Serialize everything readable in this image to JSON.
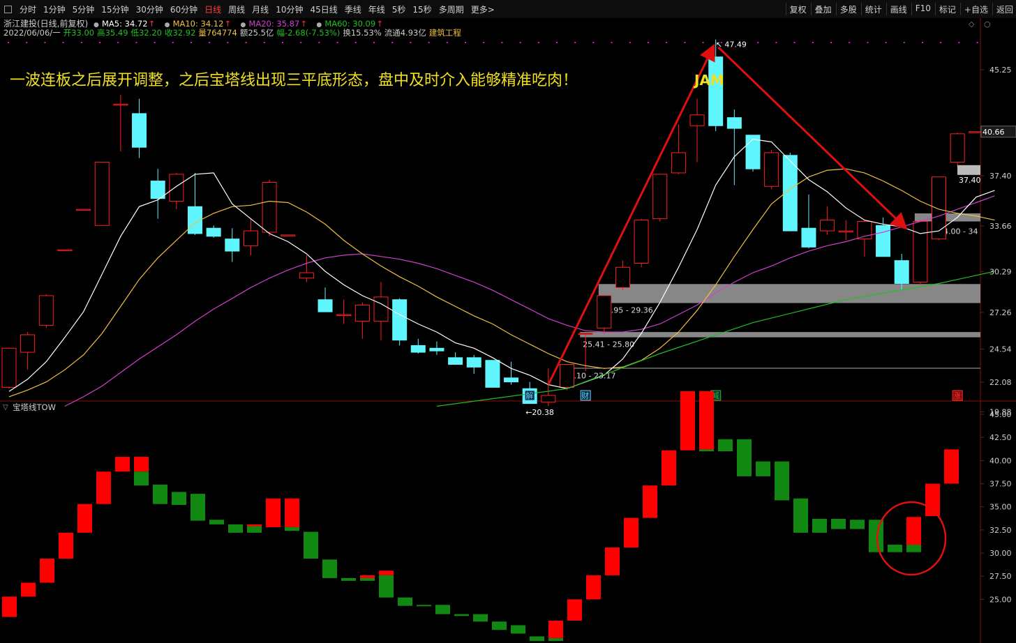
{
  "toolbar": {
    "left": [
      "分时",
      "1分钟",
      "5分钟",
      "15分钟",
      "30分钟",
      "60分钟",
      "日线",
      "周线",
      "月线",
      "10分钟",
      "45日线",
      "季线",
      "年线",
      "5秒",
      "15秒",
      "多周期",
      "更多>"
    ],
    "active": "日线",
    "right": [
      "复权",
      "叠加",
      "多股",
      "统计",
      "画线",
      "F10",
      "标记",
      "+自选",
      "返回"
    ]
  },
  "header": {
    "stock": "浙江建投(日线,前复权)",
    "ma": [
      {
        "label": "MA5: 34.72",
        "color": "#ffffff"
      },
      {
        "label": "MA10: 34.12",
        "color": "#f0c040"
      },
      {
        "label": "MA20: 35.87",
        "color": "#d040d0"
      },
      {
        "label": "MA60: 30.09",
        "color": "#20c020"
      }
    ],
    "info": [
      {
        "text": "2022/06/06/一",
        "color": "#cccccc"
      },
      {
        "text": "开33.00",
        "color": "#20c020"
      },
      {
        "text": "高35.49",
        "color": "#20c020"
      },
      {
        "text": "低32.20",
        "color": "#20c020"
      },
      {
        "text": "收32.92",
        "color": "#20c020"
      },
      {
        "text": "量764774",
        "color": "#f0c040"
      },
      {
        "text": "额25.5亿",
        "color": "#cccccc"
      },
      {
        "text": "幅-2.68(-7.53%)",
        "color": "#20c020"
      },
      {
        "text": "换15.53%",
        "color": "#cccccc"
      },
      {
        "text": "流通4.93亿",
        "color": "#cccccc"
      },
      {
        "text": "建筑工程",
        "color": "#f0c040"
      }
    ],
    "annotation": "一波连板之后展开调整，之后宝塔线出现三平底形态，盘中及时介入能够精准吃肉！",
    "watermark": "JAM"
  },
  "colors": {
    "up": "#ff2020",
    "down": "#5ff5ff",
    "tow_up": "#ff0000",
    "tow_down": "#118811",
    "ma5": "#ffffff",
    "ma10": "#f0c040",
    "ma20": "#d040d0",
    "ma60": "#20c020",
    "arrow": "#e01010"
  },
  "chart_data": [
    {
      "type": "candlestick",
      "title": "浙江建投(日线,前复权)",
      "x": [
        "d1",
        "d2",
        "d3",
        "d4",
        "d5",
        "d6",
        "d7",
        "d8",
        "d9",
        "d10",
        "d11",
        "d12",
        "d13",
        "d14",
        "d15",
        "d16",
        "d17",
        "d18",
        "d19",
        "d20",
        "d21",
        "d22",
        "d23",
        "d24",
        "d25",
        "d26",
        "d27",
        "d28",
        "d29",
        "d30",
        "d31",
        "d32",
        "d33",
        "d34",
        "d35",
        "d36",
        "d37",
        "d38",
        "d39",
        "d40",
        "d41",
        "d42",
        "d43",
        "d44",
        "d45",
        "d46",
        "d47",
        "d48",
        "d49",
        "d50",
        "d51",
        "d52",
        "d53",
        "d54"
      ],
      "ohlc": [
        [
          21.7,
          24.6,
          21.6,
          24.6
        ],
        [
          24.3,
          25.8,
          23.0,
          25.6
        ],
        [
          26.3,
          28.6,
          26.1,
          28.5
        ],
        [
          31.9,
          31.9,
          31.9,
          31.9
        ],
        [
          34.9,
          34.9,
          34.9,
          34.9
        ],
        [
          33.7,
          38.4,
          33.7,
          38.4
        ],
        [
          42.7,
          43.4,
          39.2,
          42.7
        ],
        [
          42.0,
          43.1,
          38.7,
          39.5
        ],
        [
          37.0,
          37.9,
          34.2,
          35.7
        ],
        [
          35.5,
          37.6,
          34.9,
          37.5
        ],
        [
          35.1,
          37.6,
          33.0,
          33.1
        ],
        [
          33.5,
          33.7,
          32.8,
          32.9
        ],
        [
          32.7,
          33.5,
          31.0,
          31.8
        ],
        [
          32.2,
          34.2,
          31.5,
          33.3
        ],
        [
          33.2,
          37.1,
          32.9,
          36.9
        ],
        [
          33.0,
          33.0,
          33.0,
          33.0
        ],
        [
          29.8,
          31.5,
          29.5,
          30.2
        ],
        [
          28.2,
          29.1,
          27.4,
          27.3
        ],
        [
          27.1,
          28.2,
          26.4,
          27.1
        ],
        [
          26.6,
          28.0,
          25.3,
          27.8
        ],
        [
          26.6,
          29.5,
          25.2,
          28.4
        ],
        [
          28.2,
          28.3,
          24.8,
          25.2
        ],
        [
          24.8,
          25.3,
          24.2,
          24.3
        ],
        [
          24.6,
          25.1,
          24.1,
          24.4
        ],
        [
          23.9,
          24.3,
          23.4,
          23.4
        ],
        [
          23.9,
          24.1,
          22.7,
          23.2
        ],
        [
          23.7,
          23.7,
          21.7,
          21.7
        ],
        [
          22.4,
          23.6,
          21.9,
          22.1
        ],
        [
          21.6,
          22.1,
          20.5,
          20.5
        ],
        [
          20.6,
          23.1,
          20.3,
          21.1
        ],
        [
          21.7,
          23.4,
          21.5,
          23.4
        ],
        [
          25.7,
          25.7,
          22.9,
          25.7
        ],
        [
          26.1,
          28.5,
          25.7,
          28.5
        ],
        [
          29.1,
          31.1,
          28.9,
          30.6
        ],
        [
          30.9,
          34.2,
          30.6,
          34.1
        ],
        [
          34.2,
          37.5,
          34.0,
          37.5
        ],
        [
          37.6,
          41.2,
          37.5,
          39.1
        ],
        [
          41.1,
          43.1,
          38.4,
          41.9
        ],
        [
          46.2,
          47.49,
          40.7,
          41.1
        ],
        [
          41.7,
          42.3,
          36.7,
          40.9
        ],
        [
          40.4,
          40.4,
          37.7,
          37.9
        ],
        [
          36.6,
          39.3,
          36.4,
          39.1
        ],
        [
          38.9,
          39.1,
          33.3,
          33.3
        ],
        [
          33.5,
          36.0,
          32.0,
          32.1
        ],
        [
          33.3,
          35.1,
          33.0,
          34.1
        ],
        [
          33.3,
          34.1,
          32.6,
          33.3
        ],
        [
          32.7,
          34.1,
          31.4,
          34.0
        ],
        [
          33.7,
          34.3,
          31.4,
          31.4
        ],
        [
          31.1,
          31.6,
          28.9,
          29.4
        ],
        [
          29.5,
          34.1,
          29.3,
          34.0
        ],
        [
          32.7,
          36.7,
          32.6,
          37.3
        ],
        [
          38.4,
          40.6,
          38.0,
          40.5
        ],
        [
          40.66,
          40.66,
          40.66,
          40.66
        ],
        [
          40.66,
          40.66,
          40.66,
          40.66
        ]
      ],
      "ma5": [
        21.4,
        22.3,
        23.6,
        25.4,
        27.3,
        30.1,
        32.9,
        35.1,
        35.6,
        36.6,
        37.5,
        37.6,
        35.3,
        34.2,
        33.1,
        32.5,
        31.6,
        30.3,
        29.3,
        28.5,
        27.9,
        27.1,
        26.4,
        25.8,
        25.0,
        24.6,
        23.9,
        23.1,
        22.6,
        21.9,
        21.6,
        22.1,
        22.6,
        23.8,
        25.7,
        28.0,
        30.6,
        33.4,
        36.7,
        38.8,
        40.1,
        39.9,
        38.5,
        37.1,
        36.2,
        35.0,
        34.1,
        33.8,
        33.6,
        33.1,
        33.3,
        34.3,
        35.8,
        36.3
      ],
      "ma10": [
        21.0,
        21.5,
        22.1,
        23.0,
        24.1,
        25.7,
        27.7,
        29.7,
        31.3,
        32.6,
        33.9,
        34.6,
        35.1,
        35.2,
        35.5,
        35.4,
        34.7,
        33.8,
        32.6,
        31.6,
        30.7,
        29.9,
        29.2,
        28.4,
        27.7,
        27.0,
        26.4,
        25.6,
        24.9,
        24.2,
        23.6,
        23.3,
        23.1,
        23.2,
        23.7,
        24.6,
        25.8,
        27.4,
        29.3,
        31.4,
        33.4,
        35.3,
        36.4,
        37.3,
        37.8,
        37.9,
        37.6,
        37.0,
        36.3,
        35.5,
        34.9,
        34.6,
        34.4,
        34.1
      ],
      "ma20": [
        null,
        null,
        null,
        20.3,
        21.0,
        21.8,
        22.8,
        23.8,
        24.7,
        25.6,
        26.6,
        27.5,
        28.3,
        29.1,
        29.8,
        30.4,
        30.9,
        31.3,
        31.5,
        31.6,
        31.4,
        31.2,
        30.9,
        30.5,
        30.0,
        29.5,
        28.9,
        28.2,
        27.5,
        26.8,
        26.3,
        25.9,
        25.8,
        25.8,
        26.0,
        26.4,
        27.1,
        27.8,
        28.7,
        29.5,
        30.2,
        30.7,
        31.3,
        31.8,
        32.2,
        32.5,
        32.9,
        33.2,
        33.6,
        34.0,
        34.4,
        34.9,
        35.4,
        35.9
      ],
      "ma60_points": [
        [
          23,
          20.3
        ],
        [
          30,
          21.6
        ],
        [
          35,
          24.2
        ],
        [
          40,
          26.5
        ],
        [
          45,
          28.2
        ],
        [
          50,
          29.4
        ],
        [
          53,
          30.3
        ]
      ],
      "price_ticks": [
        19.88,
        22.08,
        24.54,
        27.26,
        30.29,
        33.66,
        37.4,
        45.25
      ],
      "current_price": 40.66,
      "annotations": [
        {
          "label": "47.49",
          "index": 38,
          "value": 47.49
        },
        {
          "label": "←20.38",
          "index": 28,
          "value": 20.38
        },
        {
          "label": "37.40",
          "index": 52,
          "value": 37.4
        }
      ],
      "zones": [
        {
          "label": "23.10 - 23.17",
          "low": 23.1,
          "high": 23.17,
          "from_index": 30
        },
        {
          "label": "25.41 - 25.80",
          "low": 25.41,
          "high": 25.8,
          "from_index": 31
        },
        {
          "label": "27.95 - 29.36",
          "low": 27.95,
          "high": 29.36,
          "from_index": 32
        },
        {
          "label": "34.00 - 34",
          "low": 34.0,
          "high": 34.6,
          "from_index": 49
        }
      ],
      "markers": [
        {
          "label": "解",
          "index": 28,
          "color": "#5fd0ff"
        },
        {
          "label": "财",
          "index": 31,
          "color": "#5fd0ff"
        },
        {
          "label": "减",
          "index": 38,
          "color": "#20c020"
        },
        {
          "label": "涨",
          "index": 51,
          "color": "#ff3030"
        }
      ]
    },
    {
      "type": "bar",
      "title": "宝塔线TOW",
      "ylim": [
        22.6,
        46.0
      ],
      "y_ticks": [
        25.0,
        27.5,
        30.0,
        32.5,
        35.0,
        37.5,
        40.0,
        42.5,
        45.0
      ],
      "bricks": [
        {
          "low": 23.1,
          "high": 25.3,
          "split": null,
          "up": true
        },
        {
          "low": 25.3,
          "high": 26.8,
          "split": null,
          "up": true
        },
        {
          "low": 26.8,
          "high": 29.4,
          "split": null,
          "up": true
        },
        {
          "low": 29.4,
          "high": 32.2,
          "split": null,
          "up": true
        },
        {
          "low": 32.2,
          "high": 35.3,
          "split": null,
          "up": true
        },
        {
          "low": 35.3,
          "high": 38.8,
          "split": null,
          "up": true
        },
        {
          "low": 38.8,
          "high": 40.4,
          "split": null,
          "up": true
        },
        {
          "low": 37.3,
          "high": 40.4,
          "split": 38.8,
          "up": false
        },
        {
          "low": 35.3,
          "high": 37.4,
          "split": null,
          "up": false
        },
        {
          "low": 35.2,
          "high": 36.6,
          "split": null,
          "up": false
        },
        {
          "low": 33.5,
          "high": 36.4,
          "split": null,
          "up": false
        },
        {
          "low": 33.1,
          "high": 33.6,
          "split": null,
          "up": false
        },
        {
          "low": 32.2,
          "high": 33.1,
          "split": null,
          "up": false
        },
        {
          "low": 32.2,
          "high": 33.1,
          "split": 32.9,
          "up": false
        },
        {
          "low": 32.8,
          "high": 35.9,
          "split": null,
          "up": true
        },
        {
          "low": 32.4,
          "high": 35.9,
          "split": 32.8,
          "up": false
        },
        {
          "low": 29.4,
          "high": 32.3,
          "split": null,
          "up": false
        },
        {
          "low": 27.3,
          "high": 29.3,
          "split": null,
          "up": false
        },
        {
          "low": 27.0,
          "high": 27.3,
          "split": null,
          "up": false
        },
        {
          "low": 27.0,
          "high": 27.6,
          "split": 27.3,
          "up": false
        },
        {
          "low": 25.2,
          "high": 28.1,
          "split": 27.6,
          "up": false
        },
        {
          "low": 24.3,
          "high": 25.2,
          "split": null,
          "up": false
        },
        {
          "low": 24.3,
          "high": 24.4,
          "split": null,
          "up": false
        },
        {
          "low": 23.4,
          "high": 24.4,
          "split": null,
          "up": false
        },
        {
          "low": 23.2,
          "high": 23.4,
          "split": null,
          "up": false
        },
        {
          "low": 22.6,
          "high": 23.4,
          "split": null,
          "up": false
        },
        {
          "low": 21.7,
          "high": 22.6,
          "split": null,
          "up": false
        },
        {
          "low": 21.3,
          "high": 22.2,
          "split": null,
          "up": false
        },
        {
          "low": 20.5,
          "high": 21.0,
          "split": null,
          "up": false
        },
        {
          "low": 20.5,
          "high": 22.7,
          "split": 20.8,
          "up": true
        },
        {
          "low": 22.7,
          "high": 25.0,
          "split": null,
          "up": true
        },
        {
          "low": 25.0,
          "high": 27.6,
          "split": null,
          "up": true
        },
        {
          "low": 27.6,
          "high": 30.6,
          "split": null,
          "up": true
        },
        {
          "low": 30.6,
          "high": 33.8,
          "split": null,
          "up": true
        },
        {
          "low": 33.8,
          "high": 37.3,
          "split": null,
          "up": true
        },
        {
          "low": 37.3,
          "high": 41.1,
          "split": null,
          "up": true
        },
        {
          "low": 41.1,
          "high": 47.49,
          "split": null,
          "up": true
        },
        {
          "low": 41.0,
          "high": 47.49,
          "split": 41.2,
          "up": false
        },
        {
          "low": 41.0,
          "high": 42.3,
          "split": null,
          "up": false
        },
        {
          "low": 38.3,
          "high": 42.3,
          "split": null,
          "up": false
        },
        {
          "low": 38.3,
          "high": 39.9,
          "split": null,
          "up": false
        },
        {
          "low": 35.7,
          "high": 39.9,
          "split": null,
          "up": false
        },
        {
          "low": 32.2,
          "high": 35.9,
          "split": null,
          "up": false
        },
        {
          "low": 32.2,
          "high": 33.7,
          "split": null,
          "up": false
        },
        {
          "low": 32.6,
          "high": 33.7,
          "split": null,
          "up": false
        },
        {
          "low": 32.6,
          "high": 33.6,
          "split": null,
          "up": false
        },
        {
          "low": 30.1,
          "high": 33.6,
          "split": null,
          "up": false
        },
        {
          "low": 30.1,
          "high": 30.9,
          "split": null,
          "up": false
        },
        {
          "low": 30.1,
          "high": 33.9,
          "split": 30.9,
          "up": true
        },
        {
          "low": 34.0,
          "high": 37.5,
          "split": null,
          "up": true
        },
        {
          "low": 37.5,
          "high": 41.2,
          "split": null,
          "up": true
        }
      ]
    }
  ]
}
